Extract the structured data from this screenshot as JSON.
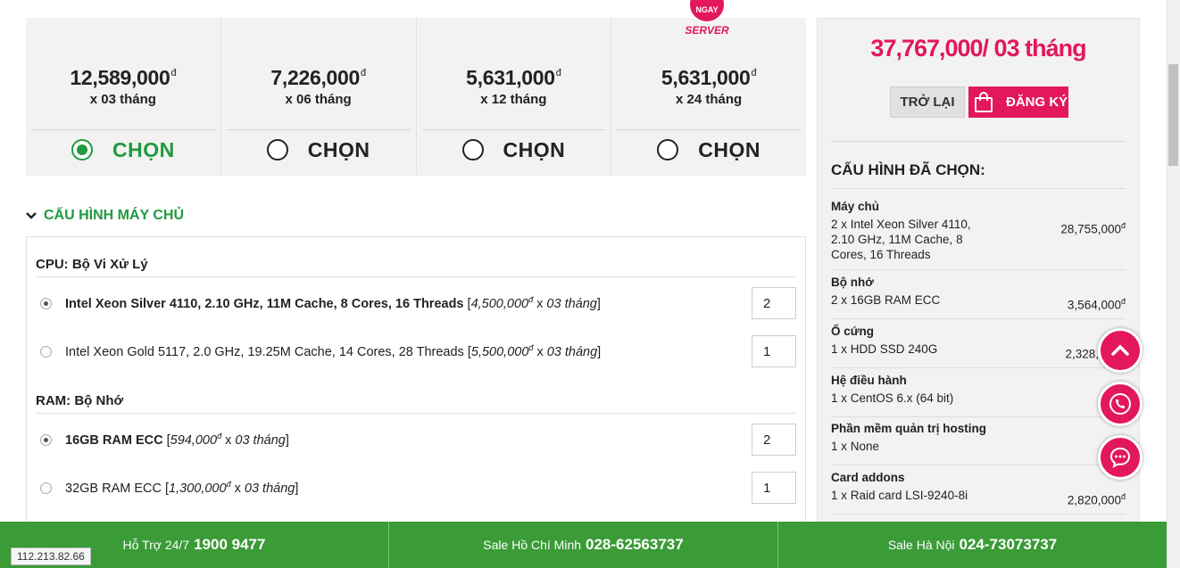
{
  "plans": [
    {
      "price": "12,589,000",
      "currency": "đ",
      "duration": "x 03 tháng",
      "choose_label": "CHỌN",
      "selected": true
    },
    {
      "price": "7,226,000",
      "currency": "đ",
      "duration": "x 06 tháng",
      "choose_label": "CHỌN",
      "selected": false
    },
    {
      "price": "5,631,000",
      "currency": "đ",
      "duration": "x 12 tháng",
      "choose_label": "CHỌN",
      "selected": false
    },
    {
      "price": "5,631,000",
      "currency": "đ",
      "duration": "x 24 tháng",
      "choose_label": "CHỌN",
      "selected": false
    }
  ],
  "badge": {
    "top_text": "NGAY",
    "bottom_text": "SERVER"
  },
  "config": {
    "section_title": "CẤU HÌNH MÁY CHỦ",
    "groups": [
      {
        "title": "CPU: Bộ Vi Xử Lý",
        "options": [
          {
            "name": "Intel Xeon Silver 4110, 2.10 GHz, 11M Cache, 8 Cores, 16 Threads",
            "price": "4,500,000",
            "currency": "đ",
            "mult": "x",
            "duration": "03 tháng",
            "qty": "2",
            "selected": true
          },
          {
            "name": "Intel Xeon Gold 5117, 2.0 GHz, 19.25M Cache, 14 Cores, 28 Threads",
            "price": "5,500,000",
            "currency": "đ",
            "mult": "x",
            "duration": "03 tháng",
            "qty": "1",
            "selected": false
          }
        ]
      },
      {
        "title": "RAM: Bộ Nhớ",
        "options": [
          {
            "name": "16GB RAM ECC",
            "price": "594,000",
            "currency": "đ",
            "mult": "x",
            "duration": "03 tháng",
            "qty": "2",
            "selected": true
          },
          {
            "name": "32GB RAM ECC",
            "price": "1,300,000",
            "currency": "đ",
            "mult": "x",
            "duration": "03 tháng",
            "qty": "1",
            "selected": false
          }
        ]
      }
    ]
  },
  "summary": {
    "total": "37,767,000/ 03 tháng",
    "back_label": "TRỞ LẠI",
    "register_label": "ĐĂNG KÝ",
    "title": "CẤU HÌNH ĐÃ CHỌN:",
    "items": [
      {
        "title": "Máy chủ",
        "desc": "2 x Intel Xeon Silver 4110, 2.10 GHz, 11M Cache, 8 Cores, 16 Threads",
        "price": "28,755,000",
        "currency": "đ"
      },
      {
        "title": "Bộ nhớ",
        "desc": "2 x 16GB RAM ECC",
        "price": "3,564,000",
        "currency": "đ"
      },
      {
        "title": "Ổ cứng",
        "desc": "1 x HDD SSD 240G",
        "price": "2,328,",
        "currency": ""
      },
      {
        "title": "Hệ điều hành",
        "desc": "1 x CentOS 6.x (64 bit)",
        "price": "",
        "currency": ""
      },
      {
        "title": "Phần mềm quản trị hosting",
        "desc": "1 x None",
        "price": "",
        "currency": ""
      },
      {
        "title": "Card addons",
        "desc": "1 x Raid card LSI-9240-8i",
        "price": "2,820,000",
        "currency": "đ"
      }
    ]
  },
  "footer": [
    {
      "label": "Hỗ Trợ 24/7",
      "phone": "1900 9477"
    },
    {
      "label": "Sale Hồ Chí Minh",
      "phone": "028-62563737"
    },
    {
      "label": "Sale Hà Nội",
      "phone": "024-73073737"
    }
  ],
  "ip": "112.213.82.66",
  "colors": {
    "brand_pink": "#e3175b",
    "brand_green": "#1f9a3f",
    "footer_green": "#3a9b37"
  },
  "icons": {
    "fab_top": "chevron-up-icon",
    "fab_phone": "phone-icon",
    "fab_chat": "chat-bubble-icon",
    "register": "shopping-bag-icon",
    "section": "chevron-down-icon"
  }
}
